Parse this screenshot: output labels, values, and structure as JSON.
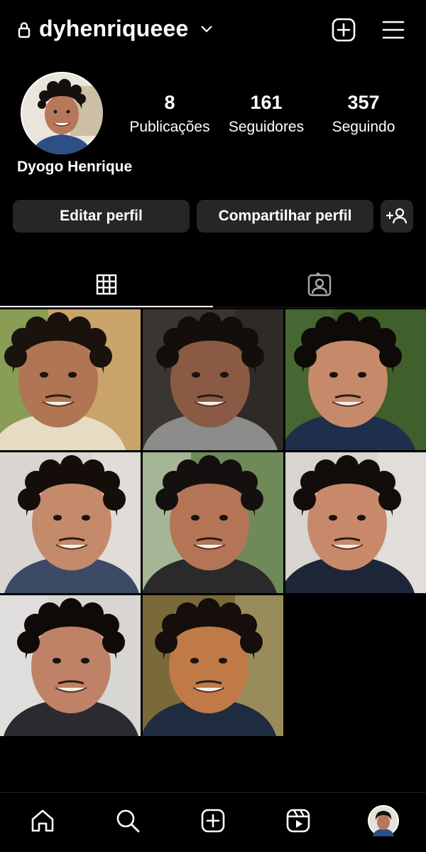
{
  "header": {
    "username": "dyhenriqueee",
    "icons": [
      "lock-icon",
      "chevron-down-icon",
      "new-post-icon",
      "menu-icon"
    ]
  },
  "profile": {
    "full_name": "Dyogo Henrique",
    "stats": [
      {
        "value": "8",
        "label": "Publicações"
      },
      {
        "value": "161",
        "label": "Seguidores"
      },
      {
        "value": "357",
        "label": "Seguindo"
      }
    ]
  },
  "actions": {
    "edit_label": "Editar perfil",
    "share_label": "Compartilhar perfil",
    "discover_icon": "add-person-icon"
  },
  "tabs": [
    {
      "name": "grid",
      "icon": "grid-icon",
      "active": true
    },
    {
      "name": "tagged",
      "icon": "tagged-person-icon",
      "active": false
    }
  ],
  "posts": [
    {
      "bg": "#c9a46a",
      "skin": "#b07552",
      "hair": "#1a120c",
      "shirt": "#e6dcc4",
      "backdrop": "#6f9a4c"
    },
    {
      "bg": "#3a3531",
      "skin": "#8a5a44",
      "hair": "#140e0a",
      "shirt": "#8c8c8a",
      "backdrop": "#2b2622"
    },
    {
      "bg": "#3f5f2b",
      "skin": "#c6896a",
      "hair": "#0e0a08",
      "shirt": "#1f2e4a",
      "backdrop": "#4c6b36"
    },
    {
      "bg": "#d9d6d2",
      "skin": "#c48a6a",
      "hair": "#140d09",
      "shirt": "#3b4b66",
      "backdrop": "#e2dfdc"
    },
    {
      "bg": "#6f8a58",
      "skin": "#b47556",
      "hair": "#151010",
      "shirt": "#2a2a2a",
      "backdrop": "#bcc9b0"
    },
    {
      "bg": "#d8d4d0",
      "skin": "#c8896a",
      "hair": "#120c0a",
      "shirt": "#1c2638",
      "backdrop": "#e4e1de"
    },
    {
      "bg": "#d8d6d3",
      "skin": "#bf8266",
      "hair": "#0f0a08",
      "shirt": "#2a2a30",
      "backdrop": "#e3e1df"
    },
    {
      "bg": "#7a6a3a",
      "skin": "#c07a48",
      "hair": "#150e0a",
      "shirt": "#1f2b3e",
      "backdrop": "#a89a6a"
    }
  ],
  "nav": [
    {
      "name": "home",
      "icon": "home-icon"
    },
    {
      "name": "search",
      "icon": "search-icon"
    },
    {
      "name": "create",
      "icon": "create-icon"
    },
    {
      "name": "reels",
      "icon": "reels-icon"
    },
    {
      "name": "profile",
      "icon": "profile-avatar-icon"
    }
  ]
}
